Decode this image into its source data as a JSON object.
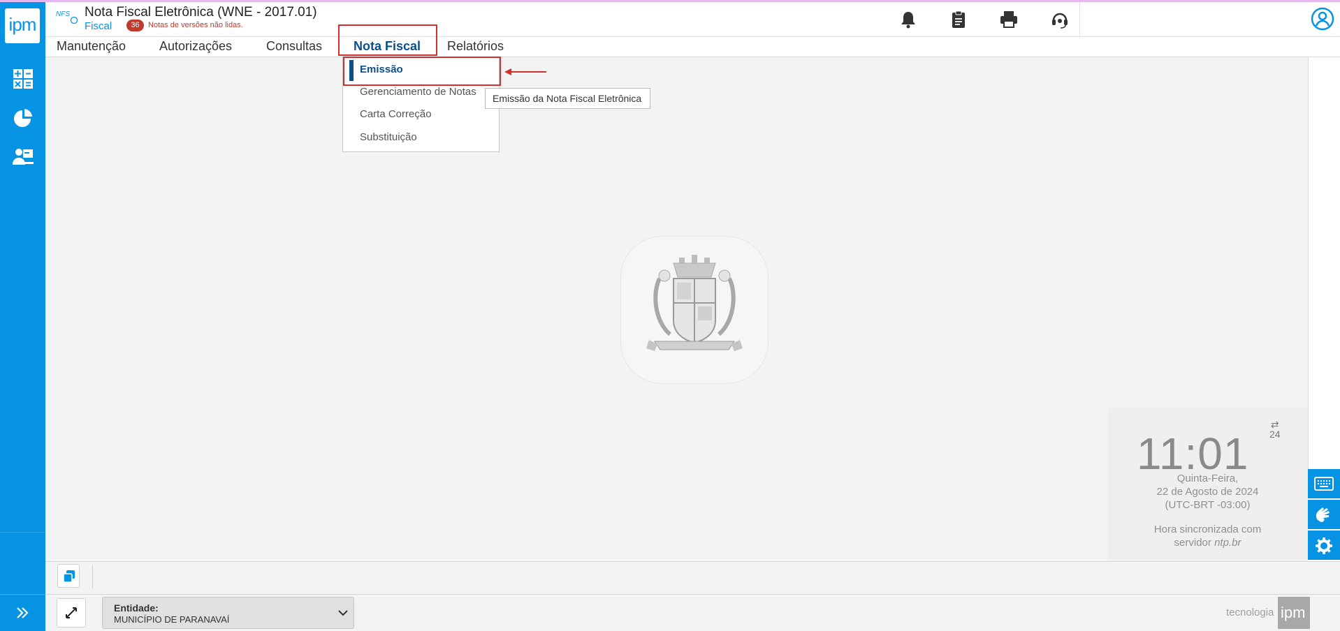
{
  "app": {
    "title": "Nota Fiscal Eletrônica (WNE - 2017.01)",
    "subtitle": "Fiscal",
    "nfse_logo": "NFS",
    "unread_count": "36",
    "unread_text": "Notas de versões não lidas.",
    "brand_logo_text": "ipm"
  },
  "header_icons": [
    "bell-icon",
    "clipboard-icon",
    "printer-icon",
    "headset-icon",
    "user-circle-icon"
  ],
  "sidebar": {
    "icons": [
      "calculator-icon",
      "pie-chart-icon",
      "user-board-icon",
      "double-chevron-right-icon"
    ]
  },
  "menu": {
    "items": [
      {
        "label": "Manutenção"
      },
      {
        "label": "Autorizações"
      },
      {
        "label": "Consultas"
      },
      {
        "label": "Nota Fiscal",
        "active": true
      },
      {
        "label": "Relatórios"
      }
    ]
  },
  "dropdown": {
    "items": [
      {
        "label": "Emissão",
        "selected": true
      },
      {
        "label": "Gerenciamento de Notas"
      },
      {
        "label": "Carta Correção"
      },
      {
        "label": "Substituição"
      }
    ],
    "tooltip": "Emissão da Nota Fiscal Eletrônica"
  },
  "clock": {
    "time": "11:01",
    "format_toggle": "24",
    "day": "Quinta-Feira,",
    "date": "22 de Agosto de 2024",
    "timezone": "(UTC-BRT -03:00)",
    "sync_line1": "Hora sincronizada com",
    "sync_line2_prefix": "servidor ",
    "sync_server": "ntp.br"
  },
  "side_tools": [
    "keyboard-icon",
    "sign-language-icon",
    "gear-icon"
  ],
  "footer": {
    "entity_label": "Entidade:",
    "entity_value": "MUNICÍPIO DE PARANAVAÍ",
    "brand_text": "tecnologia",
    "brand_logo": "ipm"
  },
  "colors": {
    "primary": "#0693e3",
    "active_menu": "#0b4f8a",
    "highlight": "#d32f2f",
    "badge": "#c0392b"
  }
}
